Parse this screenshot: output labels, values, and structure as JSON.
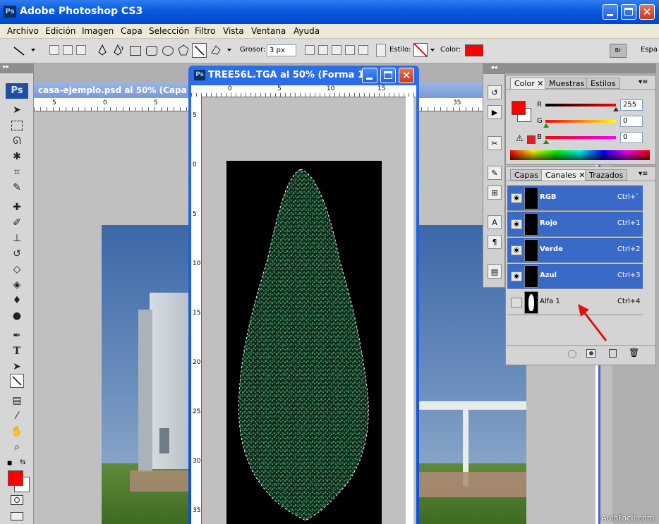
{
  "app": {
    "title": "Adobe Photoshop CS3",
    "badge": "Ps"
  },
  "menu": [
    "Archivo",
    "Edición",
    "Imagen",
    "Capa",
    "Selección",
    "Filtro",
    "Vista",
    "Ventana",
    "Ayuda"
  ],
  "options": {
    "grosor_label": "Grosor:",
    "grosor_value": "3 px",
    "estilo_label": "Estilo:",
    "color_label": "Color:",
    "color_value": "#ff0000",
    "right_label": "Espa"
  },
  "toolbox": {
    "badge": "Ps",
    "foreground": "#ff0000",
    "background": "#ffffff"
  },
  "back_doc": {
    "title": "casa-ejemplo.psd al 50% (Capa 8",
    "ruler_ticks": [
      "5",
      "0",
      "5",
      "35"
    ]
  },
  "front_doc": {
    "title": "TREE56L.TGA al 50% (Forma 1...",
    "ruler_ticks": [
      "0",
      "5",
      "10",
      "15"
    ],
    "vruler_ticks": [
      "5",
      "0",
      "5",
      "10",
      "15",
      "20",
      "25",
      "30",
      "35"
    ]
  },
  "color_panel": {
    "tabs": [
      "Color",
      "Muestras",
      "Estilos"
    ],
    "channels": [
      {
        "label": "R",
        "value": "255"
      },
      {
        "label": "G",
        "value": "0"
      },
      {
        "label": "B",
        "value": "0"
      }
    ]
  },
  "channels_panel": {
    "tabs": [
      "Capas",
      "Canales",
      "Trazados"
    ],
    "rows": [
      {
        "name": "RGB",
        "shortcut": "Ctrl+`",
        "selected": true
      },
      {
        "name": "Rojo",
        "shortcut": "Ctrl+1",
        "selected": true
      },
      {
        "name": "Verde",
        "shortcut": "Ctrl+2",
        "selected": true
      },
      {
        "name": "Azul",
        "shortcut": "Ctrl+3",
        "selected": true
      },
      {
        "name": "Alfa 1",
        "shortcut": "Ctrl+4",
        "selected": false
      }
    ]
  },
  "watermark": "AulaFacil.com"
}
